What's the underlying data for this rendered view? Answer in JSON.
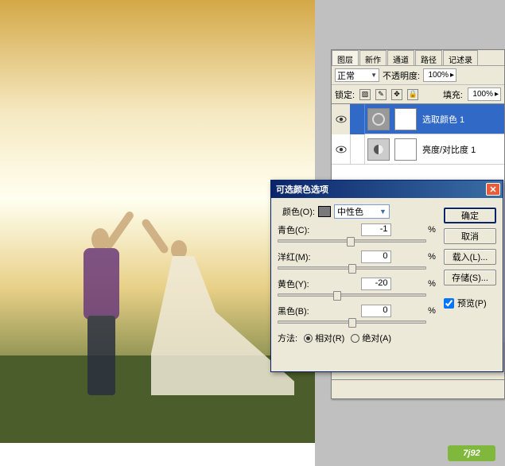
{
  "layers_panel": {
    "tabs": [
      "图层",
      "新作",
      "通道",
      "路径",
      "记述录"
    ],
    "blend_mode": "正常",
    "opacity_label": "不透明度:",
    "opacity_value": "100%",
    "lock_label": "锁定:",
    "fill_label": "填充:",
    "fill_value": "100%",
    "layers": [
      {
        "name": "选取颜色 1",
        "selected": true
      },
      {
        "name": "亮度/对比度 1",
        "selected": false
      }
    ]
  },
  "dialog": {
    "title": "可选颜色选项",
    "color_label": "颜色(O):",
    "color_selected": "中性色",
    "sliders": [
      {
        "label": "青色(C):",
        "value": "-1",
        "pos": 49
      },
      {
        "label": "洋红(M):",
        "value": "0",
        "pos": 50
      },
      {
        "label": "黄色(Y):",
        "value": "-20",
        "pos": 40
      },
      {
        "label": "黑色(B):",
        "value": "0",
        "pos": 50
      }
    ],
    "method_label": "方法:",
    "method_relative": "相对(R)",
    "method_absolute": "绝对(A)",
    "buttons": {
      "ok": "确定",
      "cancel": "取消",
      "load": "载入(L)...",
      "save": "存储(S)...",
      "preview": "预览(P)"
    }
  },
  "watermark": "7j92"
}
